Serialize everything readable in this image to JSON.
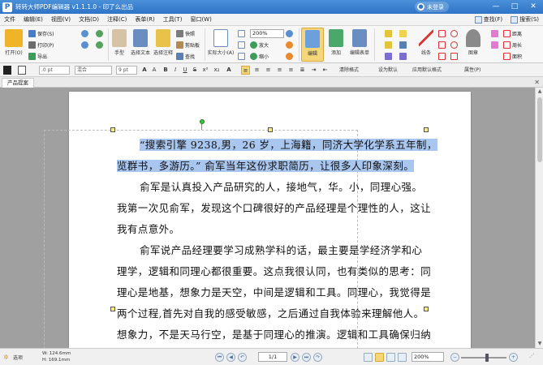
{
  "app": {
    "title": "转转大师PDF编辑器 v1.1.1.0 - 印了么出品",
    "login": "未登录"
  },
  "menu": [
    "文件",
    "编辑(E)",
    "视图(V)",
    "文档(D)",
    "注释(C)",
    "表单(R)",
    "工具(T)",
    "窗口(W)"
  ],
  "menu_right": [
    "查找(F)",
    "搜索(S)"
  ],
  "ribbon": {
    "open": "打开(O)",
    "save": "保存(S)",
    "print": "打印(P)",
    "export": "导出",
    "hand": "手型",
    "select_text": "选择文本",
    "select_annot": "选择注释",
    "snapshot": "快照",
    "clipboard": "剪贴板",
    "find": "查找",
    "actual_size": "实际大小(A)",
    "zoom": "200%",
    "zoom_in": "放大",
    "zoom_out": "缩小",
    "edit": "编辑",
    "add": "添加",
    "edit_form": "编辑表单",
    "lines": "线条",
    "stamp": "图章",
    "distance": "距离",
    "perimeter": "周长",
    "area": "面积"
  },
  "format": {
    "stroke": ".0 pt",
    "blend": "混合",
    "font_size": "9 pt",
    "clear_format": "清除格式",
    "set_default": "设为默认",
    "apply_default": "应用默认格式",
    "props": "属性(P)"
  },
  "tab": {
    "label": "产品提案"
  },
  "document": {
    "paragraphs": [
      "“搜索引擎 9238,男，26 岁，上海籍，同济大学化学系五年制，",
      "览群书，多游历。” 俞军当年这份求职简历，让很多人印象深刻。",
      "俞军是认真投入产品研究的人，接地气，华。小，同理心强。",
      "我第一次见俞军，发现这个口碑很好的产品经理是个理性的人，这让",
      "我有点意外。",
      "俞军说产品经理要学习成熟学科的话，最主要是学经济学和心",
      "理学，逻辑和同理心都很重要。这点我很认同，也有类似的思考：同",
      "理心是地基，想象力是天空，中间是逻辑和工具。同理心，我觉得是",
      "两个过程,首先对自我的感受敏感，之后通过自我体验来理解他人。",
      "想象力，不是天马行空，是基于同理心的推演。逻辑和工具确保归纳"
    ]
  },
  "status": {
    "select": "选项",
    "width": "W: 124.6mm",
    "height": "H: 169.1mm",
    "page": "1/1",
    "zoom": "200%"
  }
}
